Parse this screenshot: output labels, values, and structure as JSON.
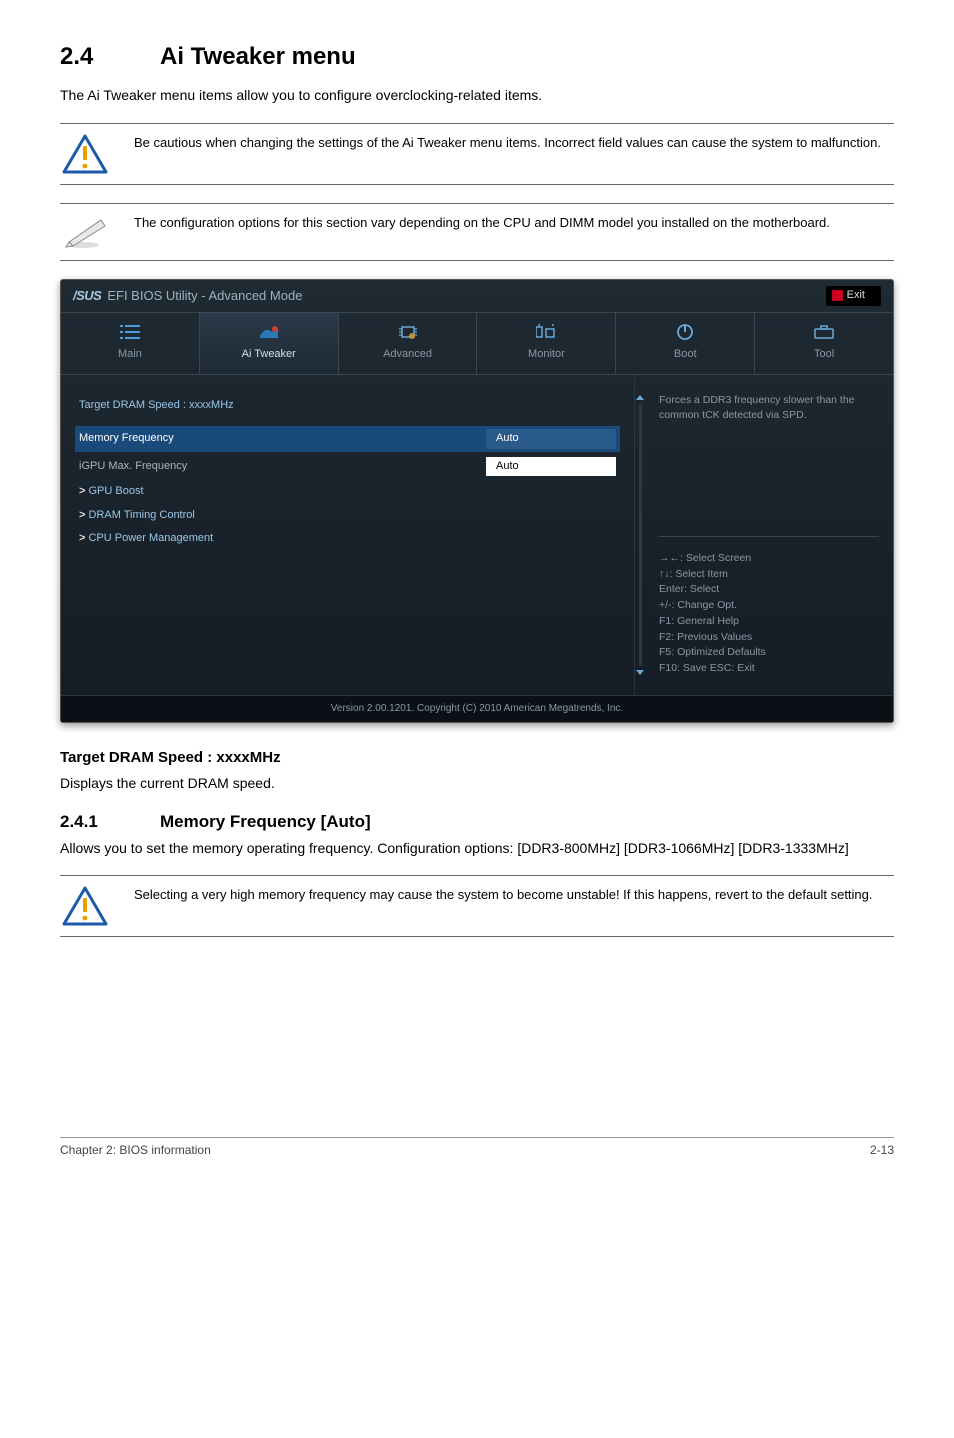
{
  "section": {
    "number": "2.4",
    "title": "Ai Tweaker menu",
    "intro": "The Ai Tweaker menu items allow you to configure overclocking-related items."
  },
  "callouts": {
    "caution1": "Be cautious when changing the settings of the Ai Tweaker menu items. Incorrect field values can cause the system to malfunction.",
    "note1": "The configuration options for this section vary depending on the CPU and DIMM model you installed on the motherboard."
  },
  "bios": {
    "titleBrand": "/SUS",
    "titleText": "EFI BIOS Utility - Advanced Mode",
    "exitLabel": "Exit",
    "tabs": {
      "main": "Main",
      "aitweaker": "Ai  Tweaker",
      "advanced": "Advanced",
      "monitor": "Monitor",
      "boot": "Boot",
      "tool": "Tool"
    },
    "rows": {
      "target": "Target DRAM Speed : xxxxMHz",
      "memfreqLabel": "Memory Frequency",
      "memfreqValue": "Auto",
      "igpuLabel": "iGPU Max. Frequency",
      "igpuValue": "Auto",
      "gpuboost": "GPU Boost",
      "dramtiming": "DRAM Timing Control",
      "cpupower": "CPU Power Management"
    },
    "help": "Forces a DDR3 frequency slower than the common tCK detected via SPD.",
    "nav": "→←:  Select Screen\n↑↓:  Select Item\nEnter:  Select\n+/-:  Change Opt.\nF1:  General Help\nF2:  Previous Values\nF5:  Optimized Defaults\nF10:  Save   ESC:  Exit",
    "footer": "Version  2.00.1201.   Copyright  (C)  2010  American  Megatrends,  Inc."
  },
  "sub1": {
    "heading": "Target DRAM Speed : xxxxMHz",
    "text": "Displays the current DRAM speed."
  },
  "sub241": {
    "num": "2.4.1",
    "heading": "Memory Frequency [Auto]",
    "text": "Allows you to set the memory operating frequency. Configuration options: [DDR3-800MHz] [DDR3-1066MHz] [DDR3-1333MHz]"
  },
  "callouts2": {
    "caution2": "Selecting a very high memory frequency may cause the system to become unstable! If this happens, revert to the default setting."
  },
  "footer": {
    "left": "Chapter 2: BIOS information",
    "right": "2-13"
  }
}
